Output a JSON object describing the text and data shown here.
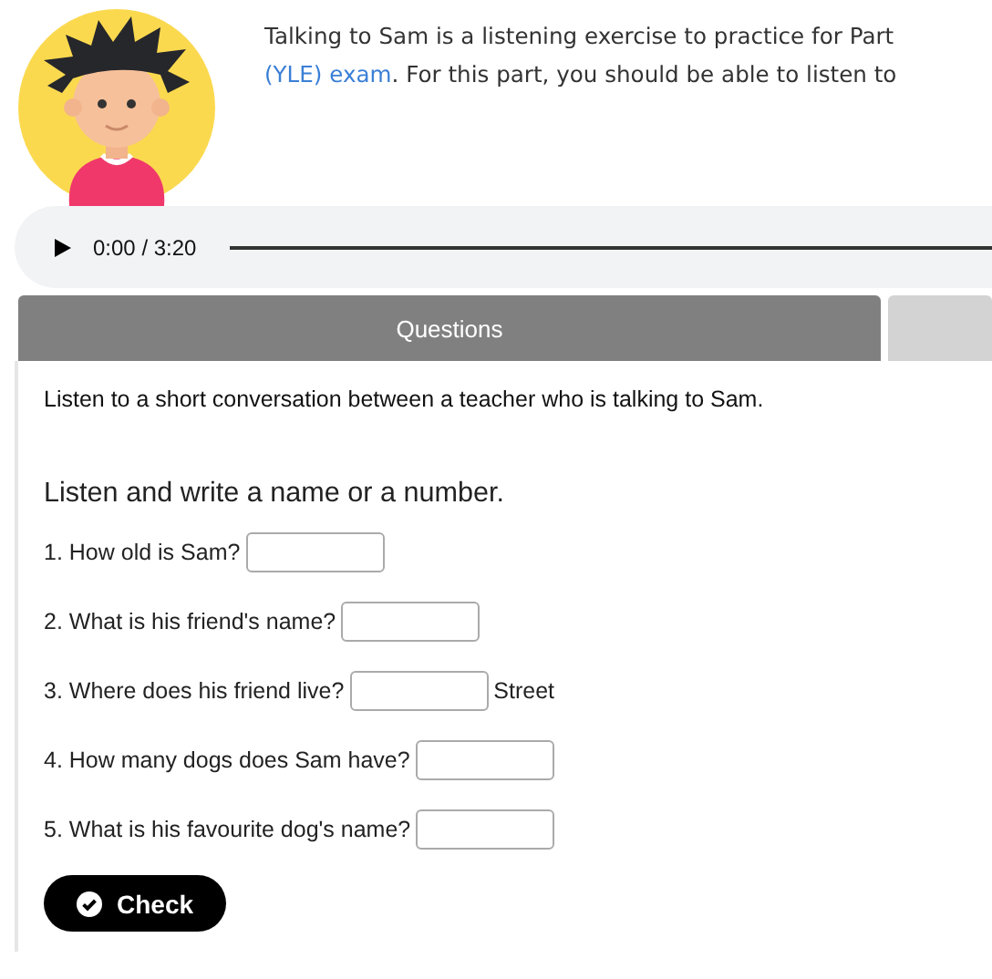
{
  "intro": {
    "line_1": "Talking to Sam is a listening exercise to practice for Part",
    "link": "(YLE) exam",
    "line_2_rest": ". For this part, you should be able to listen to"
  },
  "audio": {
    "time": "0:00 / 3:20"
  },
  "tabs": [
    {
      "label": "Questions",
      "selected": true
    },
    {
      "selected": false
    }
  ],
  "instruction": "Listen to a short conversation between a teacher who is talking to Sam.",
  "heading": "Listen and write a name or a number.",
  "questions": [
    {
      "label": "1. How old is Sam?"
    },
    {
      "label": "2. What is his friend's name?"
    },
    {
      "label": "3. Where does his friend live?",
      "suffix": "Street"
    },
    {
      "label": "4. How many dogs does Sam have?"
    },
    {
      "label": "5. What is his favourite dog's name?"
    }
  ],
  "check_button": "Check"
}
